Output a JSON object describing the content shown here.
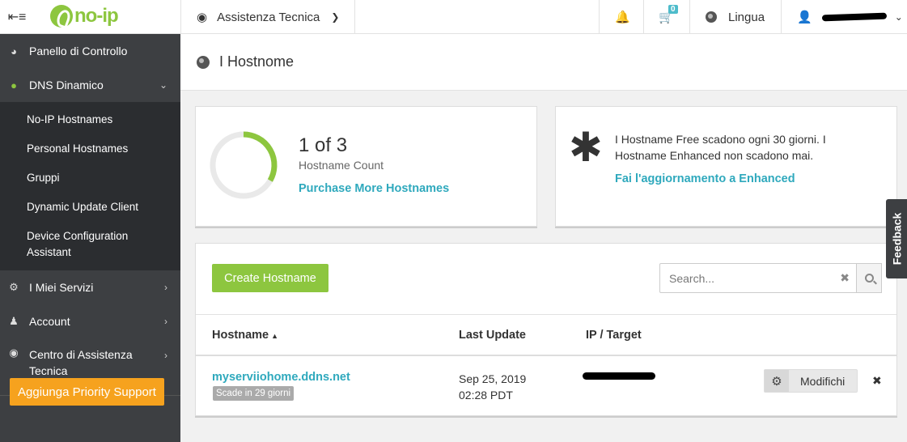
{
  "topbar": {
    "support_label": "Assistenza Tecnica",
    "cart_count": "0",
    "language_label": "Lingua",
    "logo_text": "no-ip"
  },
  "sidebar": {
    "items": [
      {
        "label": "Panello di Controllo",
        "icon": "dashboard-icon"
      },
      {
        "label": "DNS Dinamico",
        "icon": "globe-icon"
      },
      {
        "label": "I Miei Servizi",
        "icon": "gear-icon"
      },
      {
        "label": "Account",
        "icon": "user-icon"
      },
      {
        "label": "Centro di Assistenza Tecnica",
        "icon": "lifebuoy-icon"
      }
    ],
    "sub_items": [
      "No-IP Hostnames",
      "Personal Hostnames",
      "Gruppi",
      "Dynamic Update Client",
      "Device Configuration Assistant"
    ],
    "priority_button": "Aggiunga Priority Support"
  },
  "page": {
    "title": "I Hostnome"
  },
  "hostname_count": {
    "count_text": "1 of 3",
    "label": "Hostname Count",
    "used": 1,
    "total": 3,
    "purchase_link": "Purchase More Hostnames"
  },
  "info": {
    "text": "I Hostname Free scadono ogni 30 giorni. I Hostname Enhanced non scadono mai.",
    "upgrade_link": "Fai l'aggiornamento a Enhanced"
  },
  "table": {
    "create_button": "Create Hostname",
    "search_placeholder": "Search...",
    "columns": [
      "Hostname",
      "Last Update",
      "IP / Target"
    ],
    "rows": [
      {
        "hostname": "myserviiohome.ddns.net",
        "badge": "Scade in 29 giorni",
        "date": "Sep 25, 2019",
        "time": "02:28 PDT",
        "edit_label": "Modifichi"
      }
    ]
  },
  "feedback_label": "Feedback",
  "colors": {
    "accent_green": "#8dc63f",
    "link_teal": "#2fa9bd",
    "priority_orange": "#f6a21e",
    "sidebar_dark": "#3d3f42"
  }
}
